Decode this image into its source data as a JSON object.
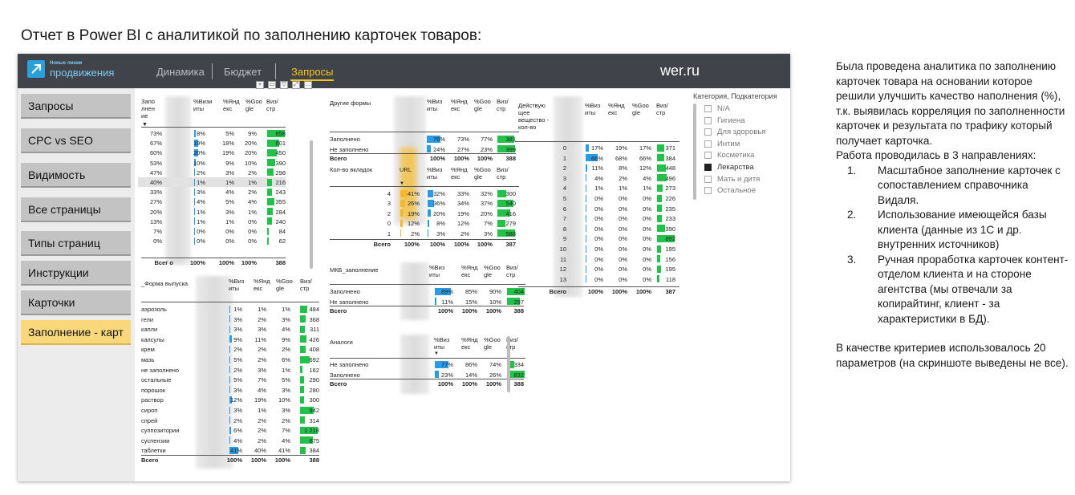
{
  "slide_title": "Отчет в Power BI с аналитикой по заполнению карточек товаров:",
  "logo": {
    "top": "Новые линии",
    "bottom": "продвижения"
  },
  "nav": {
    "tabs": [
      "Динамика",
      "Бюджет",
      "Запросы"
    ],
    "active": "Запросы",
    "site": "wer.ru"
  },
  "sidebar": {
    "items": [
      "Запросы",
      "CPC vs SEO",
      "Видимость",
      "Все страницы",
      "Типы страниц",
      "Инструкции",
      "Карточки",
      "Заполнение - карт"
    ],
    "active_index": 7
  },
  "colors": {
    "topbar": "#40444a",
    "accent_yellow": "#f5c518",
    "bar_blue": "#2b9be3",
    "bar_green": "#23c04a",
    "bar_yellow": "#f5b82a",
    "sidebar_btn": "#c3c3c3",
    "sidebar_active": "#f8d87a"
  },
  "table_main": {
    "headers": [
      "Запо лнен ие",
      "%Визи иты",
      "%Янд екс",
      "%Goo gle",
      "Виз/ стр"
    ],
    "rows": [
      [
        "73%",
        "8%",
        "5%",
        "9%",
        "858"
      ],
      [
        "67%",
        "19%",
        "18%",
        "20%",
        "601"
      ],
      [
        "60%",
        "20%",
        "19%",
        "20%",
        "450"
      ],
      [
        "53%",
        "10%",
        "9%",
        "10%",
        "390"
      ],
      [
        "47%",
        "2%",
        "3%",
        "2%",
        "298"
      ],
      [
        "40%",
        "1%",
        "1%",
        "1%",
        "216"
      ],
      [
        "33%",
        "3%",
        "4%",
        "2%",
        "243"
      ],
      [
        "27%",
        "4%",
        "5%",
        "4%",
        "355"
      ],
      [
        "20%",
        "1%",
        "3%",
        "1%",
        "284"
      ],
      [
        "13%",
        "1%",
        "1%",
        "0%",
        "240"
      ],
      [
        "7%",
        "0%",
        "0%",
        "0%",
        "84"
      ],
      [
        "0%",
        "0%",
        "0%",
        "0%",
        "62"
      ]
    ],
    "total": [
      "Всег о",
      "100%",
      "100%",
      "100%",
      "388"
    ],
    "selected_row": 5
  },
  "table_forma": {
    "headers": [
      "_Форма выпуска",
      "%Виз иты",
      "%Янд екс",
      "%Goo gle",
      "Виз/ стр"
    ],
    "rows": [
      [
        "аэрозоль",
        "1%",
        "1%",
        "1%",
        "484"
      ],
      [
        "гели",
        "3%",
        "2%",
        "3%",
        "368"
      ],
      [
        "капли",
        "3%",
        "3%",
        "4%",
        "311"
      ],
      [
        "капсулы",
        "9%",
        "11%",
        "9%",
        "426"
      ],
      [
        "крем",
        "2%",
        "2%",
        "2%",
        "408"
      ],
      [
        "мазь",
        "5%",
        "2%",
        "6%",
        "692"
      ],
      [
        "не заполнено",
        "2%",
        "3%",
        "1%",
        "162"
      ],
      [
        "остальные",
        "5%",
        "7%",
        "5%",
        "290"
      ],
      [
        "порошок",
        "3%",
        "4%",
        "3%",
        "280"
      ],
      [
        "раствор",
        "12%",
        "19%",
        "10%",
        "300"
      ],
      [
        "сироп",
        "3%",
        "1%",
        "3%",
        "942"
      ],
      [
        "спрей",
        "2%",
        "2%",
        "2%",
        "314"
      ],
      [
        "суппозитории",
        "6%",
        "2%",
        "7%",
        "1 218"
      ],
      [
        "суспензии",
        "4%",
        "2%",
        "4%",
        "875"
      ],
      [
        "таблетки",
        "41%",
        "40%",
        "41%",
        "384"
      ]
    ],
    "total": [
      "Всего",
      "100%",
      "100%",
      "100%",
      "388"
    ]
  },
  "table_forms": {
    "headers": [
      "Другие формы",
      "%Виз иты",
      "%Янд екс",
      "%Goo gle",
      "Виз/ стр"
    ],
    "rows": [
      [
        "Заполнено",
        "76%",
        "73%",
        "77%",
        "381"
      ],
      [
        "Не заполнено",
        "24%",
        "27%",
        "23%",
        "399"
      ]
    ],
    "total": [
      "Всего",
      "100%",
      "100%",
      "100%",
      "388"
    ]
  },
  "table_tabs": {
    "headers": [
      "Кол-во вкладок",
      "URL",
      "%Виз иты",
      "%Янд екс",
      "%Goo gle",
      "Виз/ стр"
    ],
    "rows": [
      [
        "4",
        "41%",
        "32%",
        "33%",
        "32%",
        "300"
      ],
      [
        "3",
        "26%",
        "36%",
        "34%",
        "37%",
        "540"
      ],
      [
        "2",
        "19%",
        "20%",
        "19%",
        "20%",
        "416"
      ],
      [
        "0",
        "12%",
        "8%",
        "12%",
        "7%",
        "279"
      ],
      [
        "1",
        "2%",
        "3%",
        "2%",
        "3%",
        "588"
      ]
    ],
    "total": [
      "Всего",
      "100%",
      "100%",
      "100%",
      "100%",
      "387"
    ]
  },
  "table_mkb": {
    "headers": [
      "МКБ_заполнение",
      "%Виз иты",
      "%Янд екс",
      "%Goo gle",
      "Виз/ стр"
    ],
    "rows": [
      [
        "Заполнено",
        "89%",
        "85%",
        "90%",
        "404"
      ],
      [
        "Не заполнено",
        "11%",
        "15%",
        "10%",
        "297"
      ]
    ],
    "total": [
      "Всего",
      "100%",
      "100%",
      "100%",
      "388"
    ]
  },
  "table_analogs": {
    "headers": [
      "Аналоги",
      "%Виз иты",
      "%Янд екс",
      "%Goo gle",
      "Виз/ стр"
    ],
    "rows": [
      [
        "Не заполнено",
        "77%",
        "86%",
        "74%",
        "334"
      ],
      [
        "Заполнено",
        "23%",
        "14%",
        "26%",
        "832"
      ]
    ],
    "total": [
      "Всего",
      "100%",
      "100%",
      "100%",
      "388"
    ]
  },
  "table_active": {
    "headers": [
      "Действую щее вещество - кол-во",
      "%Виз иты",
      "%Янд екс",
      "%Goo gle",
      "Виз/ стр"
    ],
    "rows": [
      [
        "0",
        "17%",
        "19%",
        "17%",
        "371"
      ],
      [
        "1",
        "66%",
        "68%",
        "66%",
        "384"
      ],
      [
        "2",
        "11%",
        "8%",
        "12%",
        "448"
      ],
      [
        "3",
        "4%",
        "2%",
        "4%",
        "496"
      ],
      [
        "4",
        "1%",
        "1%",
        "1%",
        "273"
      ],
      [
        "5",
        "0%",
        "0%",
        "0%",
        "226"
      ],
      [
        "6",
        "0%",
        "0%",
        "0%",
        "235"
      ],
      [
        "7",
        "0%",
        "0%",
        "0%",
        "233"
      ],
      [
        "8",
        "0%",
        "0%",
        "0%",
        "390"
      ],
      [
        "9",
        "0%",
        "0%",
        "0%",
        "892"
      ],
      [
        "10",
        "0%",
        "0%",
        "0%",
        "195"
      ],
      [
        "11",
        "0%",
        "0%",
        "0%",
        "156"
      ],
      [
        "12",
        "0%",
        "0%",
        "0%",
        "195"
      ],
      [
        "13",
        "0%",
        "0%",
        "0%",
        "118"
      ]
    ],
    "total": [
      "Всего",
      "100%",
      "100%",
      "100%",
      "387"
    ]
  },
  "slicer": {
    "title": "Категория, Подкатегория",
    "items": [
      {
        "label": "N/A",
        "checked": false
      },
      {
        "label": "Гигиена",
        "checked": false
      },
      {
        "label": "Для здоровья",
        "checked": false
      },
      {
        "label": "Интим",
        "checked": false
      },
      {
        "label": "Косметика",
        "checked": false
      },
      {
        "label": "Лекарства",
        "checked": true
      },
      {
        "label": "Мать и дитя",
        "checked": false
      },
      {
        "label": "Остальное",
        "checked": false
      }
    ]
  },
  "notes": {
    "intro": "Была проведена аналитика по заполнению карточек товара на основании которое решили улучшить качество наполнения (%), т.к. выявилась корреляция по заполненности карточек и результата по трафику который получает карточка.",
    "work": "Работа проводилась в 3 направлениях:",
    "items": [
      {
        "num": "1.",
        "text": "Масштабное заполнение карточек с сопоставлением справочника Видаля."
      },
      {
        "num": "2.",
        "text": "Использование имеющейся базы клиента (данные из 1С и др. внутренних источников)"
      },
      {
        "num": "3.",
        "text": "Ручная проработка карточек контент-отделом клиента и на стороне агентства (мы отвечали за копирайтинг,  клиент - за характеристики в БД)."
      }
    ],
    "criteria": "В качестве критериев использовалось 20 параметров (на скриншоте выведены не все)."
  }
}
